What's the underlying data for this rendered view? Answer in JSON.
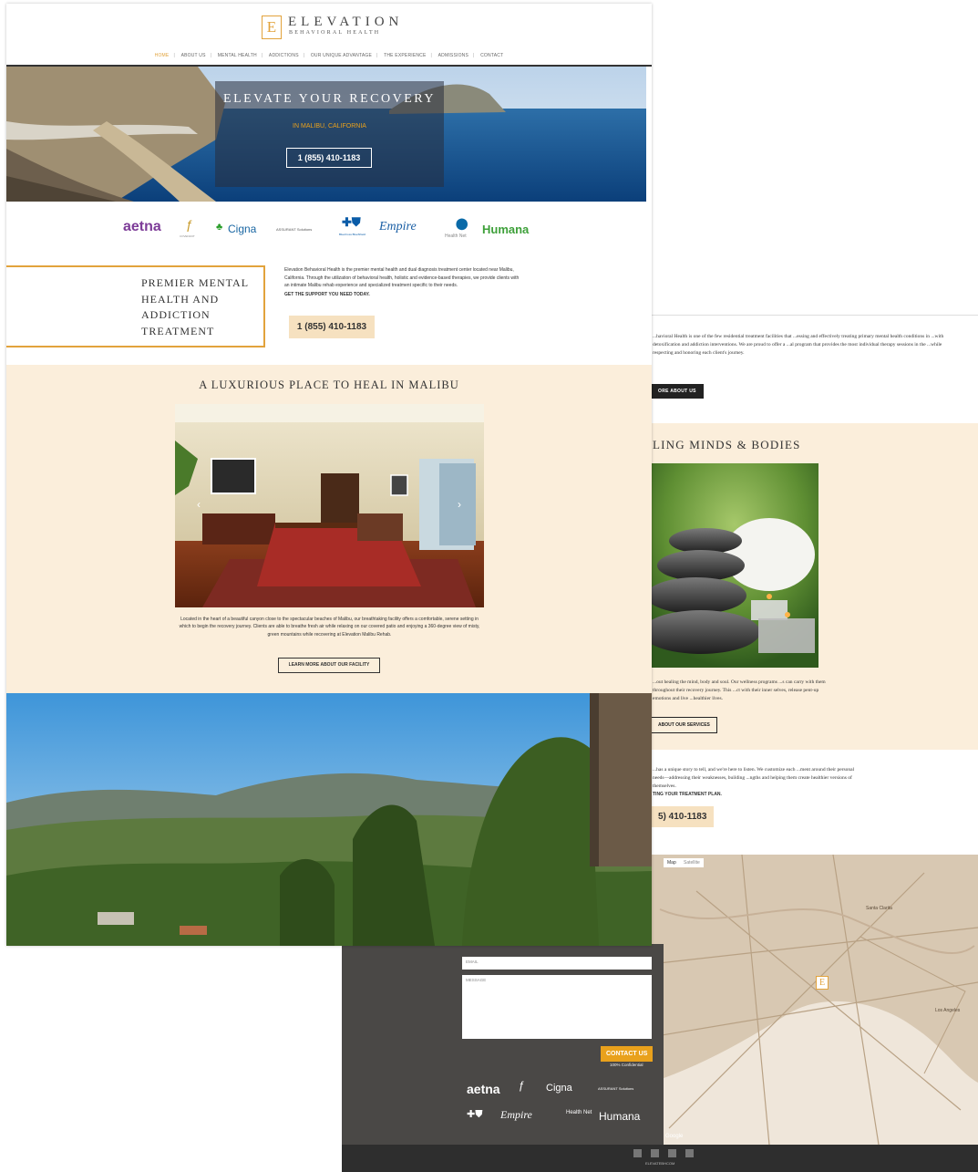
{
  "brand": {
    "logo_letter": "E",
    "name": "ELEVATION",
    "tagline": "BEHAVIORAL HEALTH",
    "accent_color": "#e2a33c"
  },
  "nav": {
    "items": [
      {
        "label": "HOME",
        "active": true
      },
      {
        "label": "ABOUT US"
      },
      {
        "label": "MENTAL HEALTH"
      },
      {
        "label": "ADDICTIONS"
      },
      {
        "label": "OUR UNIQUE ADVANTAGE"
      },
      {
        "label": "THE EXPERIENCE"
      },
      {
        "label": "ADMISSIONS"
      },
      {
        "label": "CONTACT"
      }
    ]
  },
  "hero": {
    "title": "ELEVATE YOUR RECOVERY",
    "location": "IN MALIBU, CALIFORNIA",
    "phone": "1 (855) 410-1183"
  },
  "insurers": {
    "aetna": "aetna",
    "cigna": "Cigna",
    "empire": "Empire",
    "healthnet": "Health Net",
    "humana": "Humana",
    "bluecross": "BlueCross BlueShield",
    "evernorth": "COVENANT",
    "assurant": "ASSURANT Solutions"
  },
  "premier": {
    "heading": "PREMIER MENTAL HEALTH AND ADDICTION TREATMENT",
    "body": "Elevation Behavioral Health is the premier mental health and dual diagnosis treatment center located near Malibu, California. Through the utilization of behavioral health, holistic and evidence-based therapies, we provide clients with an intimate Malibu rehab experience and specialized treatment specific to their needs.",
    "cta": "GET THE SUPPORT YOU NEED TODAY.",
    "phone": "1 (855) 410-1183"
  },
  "facility": {
    "heading": "A LUXURIOUS PLACE TO HEAL IN MALIBU",
    "body": "Located in the heart of a beautiful canyon close to the spectacular beaches of Malibu, our breathtaking facility offers a comfortable, serene setting in which to begin the recovery journey. Clients are able to breathe fresh air while relaxing on our covered patio and enjoying a 360-degree view of misty, green mountains while recovering at Elevation Malibu Rehab.",
    "button": "LEARN MORE ABOUT OUR FACILITY"
  },
  "back_page": {
    "about_text": "...havioral Health is one of the few residential treatment facilities that ...essing and effectively treating primary mental health conditions in ...with detoxification and addiction interventions. We are proud to offer a ...al program that provides the most individual therapy sessions in the ...while respecting and honoring each client's journey.",
    "about_button": "ORE ABOUT US",
    "heal_heading": "LING MINDS & BODIES",
    "wellness_text": "...out healing the mind, body and soul. Our wellness programs ...s can carry with them throughout their recovery journey. This ...ct with their inner selves, release pent-up emotions and live ...healthier lives.",
    "services_button": "ABOUT OUR SERVICES",
    "story_text": "...has a unique story to tell, and we're here to listen. We customize each ...ment around their personal needs—addressing their weaknesses, building ...ngths and helping them create healthier versions of themselves.",
    "story_cta": "TING YOUR TREATMENT PLAN.",
    "phone": "5) 410-1183",
    "map_tabs": {
      "map": "Map",
      "satellite": "Satellite"
    },
    "map_labels": {
      "santa_clarita": "Santa Clarita",
      "los_angeles": "Los Angeles",
      "google": "Google"
    }
  },
  "footer": {
    "email_placeholder": "EMAIL",
    "message_placeholder": "MESSAGE",
    "contact_button": "CONTACT US",
    "confidential": "100% Confidential",
    "copyright": "ELEVATEBHCOM"
  }
}
